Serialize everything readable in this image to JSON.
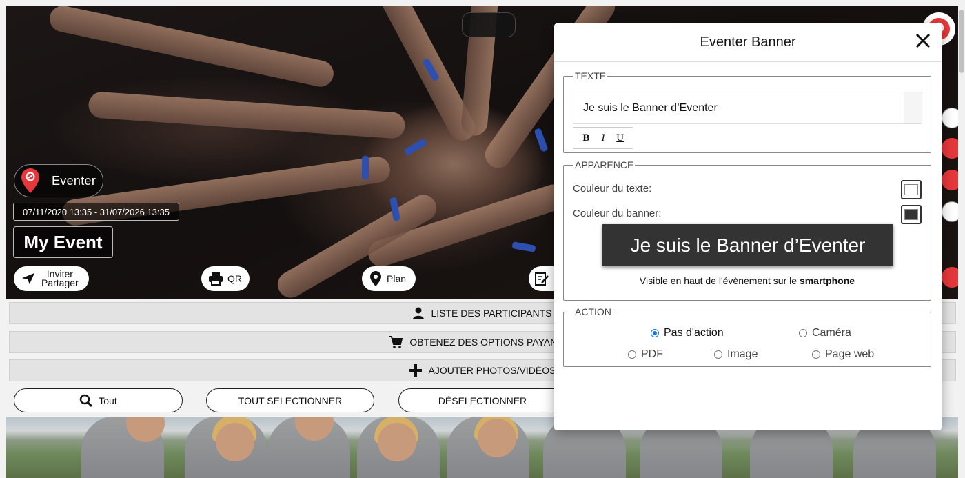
{
  "hero": {
    "brand_name": "Eventer",
    "date_range": "07/11/2020 13:35 - 31/07/2026 13:35",
    "event_title": "My Event",
    "buttons": {
      "invite_line1": "Inviter",
      "invite_line2": "Partager",
      "qr": "QR",
      "plan": "Plan"
    }
  },
  "accordion": {
    "participants": "LISTE DES PARTICIPANTS",
    "options": "OBTENEZ DES OPTIONS PAYANTES",
    "add_media": "AJOUTER PHOTOS/VIDÉOS"
  },
  "selection": {
    "filter_all": "Tout",
    "select_all": "TOUT SELECTIONNER",
    "deselect": "DÉSELECTIONNER"
  },
  "modal": {
    "title": "Eventer Banner",
    "texte": {
      "legend": "TEXTE",
      "value": "Je suis le Banner d’Eventer",
      "format_buttons": [
        "B",
        "I",
        "U"
      ]
    },
    "apparence": {
      "legend": "APPARENCE",
      "text_color_label": "Couleur du texte:",
      "text_color": "#ffffff",
      "banner_color_label": "Couleur du banner:",
      "banner_color": "#333333",
      "preview_text": "Je suis le Banner d’Eventer",
      "note_prefix": "Visible en haut de l'évènement sur le",
      "note_bold": "smartphone"
    },
    "action": {
      "legend": "ACTION",
      "options": [
        "Pas d'action",
        "Caméra",
        "PDF",
        "Image",
        "Page web"
      ],
      "selected": "Pas d'action"
    }
  },
  "colors": {
    "accent_red": "#e5383b",
    "radio_blue": "#1a73e8"
  }
}
